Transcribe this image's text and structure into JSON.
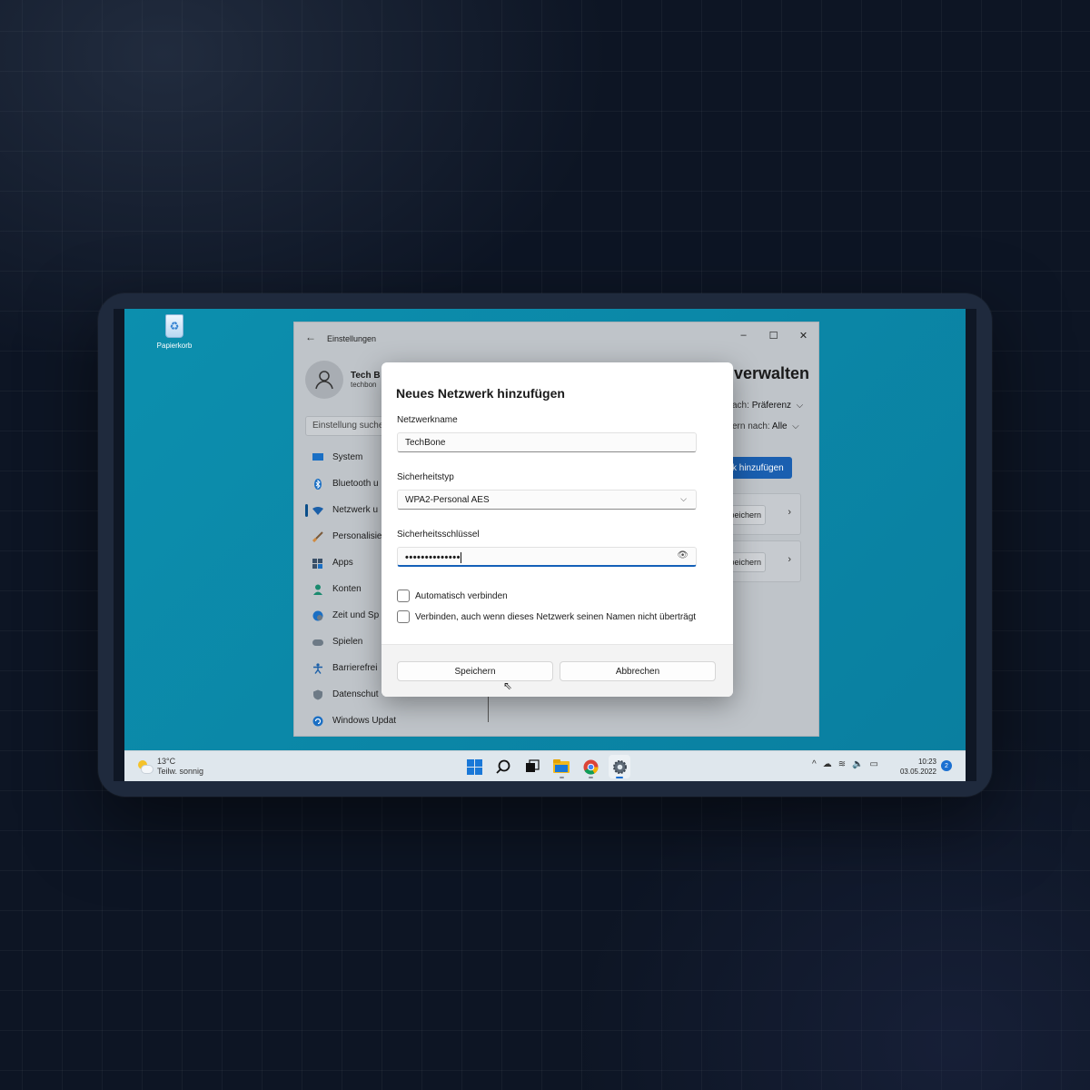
{
  "desktop": {
    "recycle_bin_label": "Papierkorb"
  },
  "settings": {
    "window_title": "Einstellungen",
    "profile_name": "Tech B",
    "profile_email": "techbon",
    "search_placeholder": "Einstellung suche",
    "nav": [
      {
        "label": "System",
        "icon": "monitor-icon"
      },
      {
        "label": "Bluetooth u",
        "icon": "bluetooth-icon"
      },
      {
        "label": "Netzwerk u",
        "icon": "wifi-icon",
        "active": true
      },
      {
        "label": "Personalisie",
        "icon": "brush-icon"
      },
      {
        "label": "Apps",
        "icon": "apps-icon"
      },
      {
        "label": "Konten",
        "icon": "person-icon"
      },
      {
        "label": "Zeit und Sp",
        "icon": "globe-clock-icon"
      },
      {
        "label": "Spielen",
        "icon": "gamepad-icon"
      },
      {
        "label": "Barrierefrei",
        "icon": "accessibility-icon"
      },
      {
        "label": "Datenschut",
        "icon": "shield-icon"
      },
      {
        "label": "Windows Update",
        "icon": "update-icon"
      }
    ],
    "page_title_fragment": "verwalten",
    "sort_label": "ach: ",
    "sort_value": "Präferenz",
    "filter_label": "ern nach: ",
    "filter_value": "Alle",
    "add_button_fragment": "k hinzufügen",
    "card_button_fragment": "peichern"
  },
  "dialog": {
    "title": "Neues Netzwerk hinzufügen",
    "network_name_label": "Netzwerkname",
    "network_name_value": "TechBone",
    "security_type_label": "Sicherheitstyp",
    "security_type_value": "WPA2-Personal AES",
    "security_key_label": "Sicherheitsschlüssel",
    "security_key_value": "••••••••••••••",
    "auto_connect_label": "Automatisch verbinden",
    "hidden_connect_label": "Verbinden, auch wenn dieses Netzwerk seinen Namen nicht überträgt",
    "save_label": "Speichern",
    "cancel_label": "Abbrechen"
  },
  "taskbar": {
    "weather_temp": "13°C",
    "weather_desc": "Teilw. sonnig",
    "time": "10:23",
    "date": "03.05.2022",
    "notification_count": "2",
    "apps": [
      "windows-start-icon",
      "search-icon",
      "task-view-icon",
      "file-explorer-icon",
      "chrome-icon",
      "settings-gear-icon"
    ]
  },
  "colors": {
    "accent": "#1460b8",
    "desktop": "#0a87a8",
    "taskbar": "#dfe7ed"
  }
}
